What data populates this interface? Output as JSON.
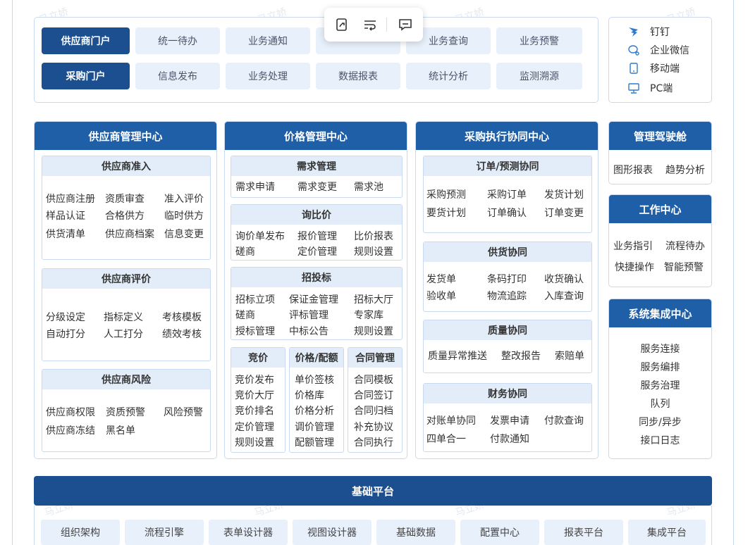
{
  "top_nav": {
    "row1": [
      "供应商门户",
      "统一待办",
      "业务通知",
      "",
      "业务查询",
      "业务预警"
    ],
    "row2": [
      "采购门户",
      "信息发布",
      "业务处理",
      "数据报表",
      "统计分析",
      "监测溯源"
    ]
  },
  "channels": [
    "钉钉",
    "企业微信",
    "移动端",
    "PC端"
  ],
  "supplier_center": {
    "title": "供应商管理中心",
    "admission": {
      "title": "供应商准入",
      "items": [
        "供应商注册",
        "资质审查",
        "准入评价",
        "样品认证",
        "合格供方",
        "临时供方",
        "供货清单",
        "供应商档案",
        "信息变更"
      ]
    },
    "evaluation": {
      "title": "供应商评价",
      "items": [
        "分级设定",
        "指标定义",
        "考核模板",
        "自动打分",
        "人工打分",
        "绩效考核"
      ]
    },
    "risk": {
      "title": "供应商风险",
      "items": [
        "供应商权限",
        "资质预警",
        "风险预警",
        "供应商冻结",
        "黑名单"
      ]
    }
  },
  "price_center": {
    "title": "价格管理中心",
    "demand": {
      "title": "需求管理",
      "items": [
        "需求申请",
        "需求变更",
        "需求池"
      ]
    },
    "inquiry": {
      "title": "询比价",
      "items": [
        "询价单发布",
        "报价管理",
        "比价报表",
        "磋商",
        "定价管理",
        "规则设置"
      ]
    },
    "bidding": {
      "title": "招投标",
      "items": [
        "招标立项",
        "保证金管理",
        "招标大厅",
        "磋商",
        "评标管理",
        "专家库",
        "授标管理",
        "中标公告",
        "规则设置"
      ]
    },
    "auction": {
      "title": "竞价",
      "items": [
        "竞价发布",
        "竞价大厅",
        "竞价排名",
        "定价管理",
        "规则设置"
      ]
    },
    "pricing": {
      "title": "价格/配额",
      "items": [
        "单价签核",
        "价格库",
        "价格分析",
        "调价管理",
        "配额管理"
      ]
    },
    "contract": {
      "title": "合同管理",
      "items": [
        "合同模板",
        "合同签订",
        "合同归档",
        "补充协议",
        "合同执行"
      ]
    }
  },
  "procurement_center": {
    "title": "采购执行协同中心",
    "order": {
      "title": "订单/预测协同",
      "items": [
        "采购预测",
        "采购订单",
        "发货计划",
        "要货计划",
        "订单确认",
        "订单变更"
      ]
    },
    "supply": {
      "title": "供货协同",
      "items": [
        "发货单",
        "条码打印",
        "收货确认",
        "验收单",
        "物流追踪",
        "入库查询"
      ]
    },
    "quality": {
      "title": "质量协同",
      "items": [
        "质量异常推送",
        "整改报告",
        "索赔单"
      ]
    },
    "finance": {
      "title": "财务协同",
      "items": [
        "对账单协同",
        "发票申请",
        "付款查询",
        "四单合一",
        "付款通知"
      ]
    }
  },
  "cockpit": {
    "title": "管理驾驶舱",
    "items": [
      "图形报表",
      "趋势分析"
    ]
  },
  "work_center": {
    "title": "工作中心",
    "items": [
      "业务指引",
      "流程待办",
      "快捷操作",
      "智能预警"
    ]
  },
  "integration_center": {
    "title": "系统集成中心",
    "items": [
      "服务连接",
      "服务编排",
      "服务治理",
      "队列",
      "同步/异步",
      "接口日志"
    ]
  },
  "base_platform": {
    "title": "基础平台",
    "items": [
      "组织架构",
      "流程引擎",
      "表单设计器",
      "视图设计器",
      "基础数据",
      "配置中心",
      "报表平台",
      "集成平台"
    ]
  },
  "watermark": "马立娇"
}
